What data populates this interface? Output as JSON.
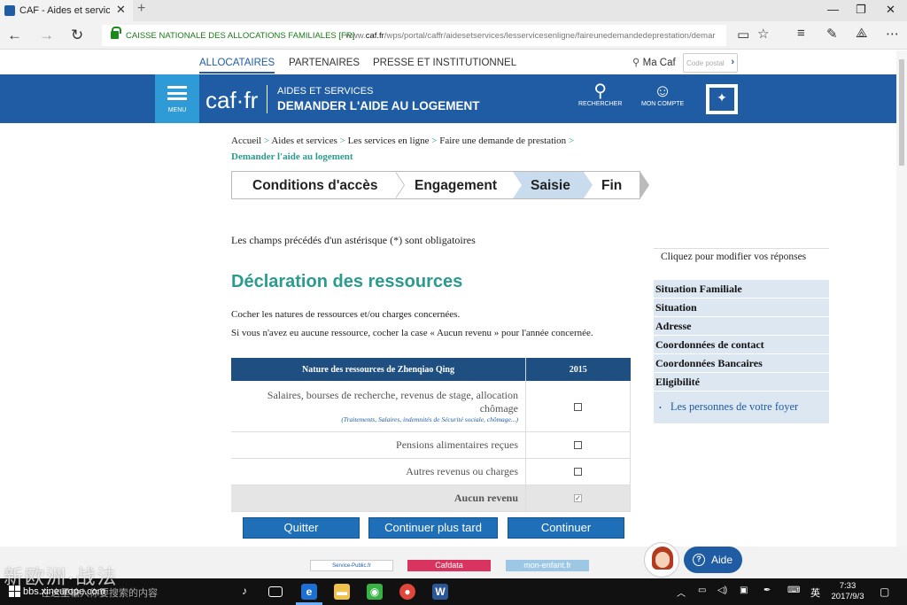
{
  "browser": {
    "tab_title": "CAF - Aides et services",
    "tab_close": "✕",
    "new_tab": "+",
    "org_name": "CAISSE NATIONALE DES ALLOCATIONS FAMILIALES [FR]",
    "url_prefix": "www.",
    "url_domain": "caf.fr",
    "url_path": "/wps/portal/caffr/aidesetservices/lesservicesenligne/faireunedemandedeprestation/demar"
  },
  "topnav": {
    "links": [
      "ALLOCATAIRES",
      "PARTENAIRES",
      "PRESSE ET INSTITUTIONNEL"
    ],
    "ma_caf": "Ma Caf",
    "postal_placeholder": "Code postal"
  },
  "header": {
    "menu_label": "MENU",
    "logo": "caf·fr",
    "title_small": "AIDES ET SERVICES",
    "title_big": "DEMANDER L'AIDE AU LOGEMENT",
    "search_label": "RECHERCHER",
    "account_label": "MON COMPTE"
  },
  "breadcrumb": {
    "items": [
      "Accueil",
      "Aides et services",
      "Les services en ligne",
      "Faire une demande de prestation"
    ],
    "separator": ">",
    "current": "Demander l'aide au logement"
  },
  "steps": [
    "Conditions d'accès",
    "Engagement",
    "Saisie",
    "Fin"
  ],
  "form": {
    "mandatory_note": "Les champs précédés d'un astérisque (*) sont obligatoires",
    "heading": "Déclaration des ressources",
    "instruction1": "Cocher les natures de ressources et/ou charges concernées.",
    "instruction2": "Si vous n'avez eu aucune ressource, cocher la case « Aucun revenu » pour l'année concernée.",
    "table": {
      "col1": "Nature des ressources de Zhenqiao Qing",
      "col2": "2015",
      "rows": [
        {
          "label": "Salaires, bourses de recherche, revenus de stage, allocation chômage",
          "sub": "(Traitements, Salaires, indemnités de Sécurité sociale, chômage...)",
          "checked": false
        },
        {
          "label": "Pensions alimentaires reçues",
          "checked": false
        },
        {
          "label": "Autres revenus ou charges",
          "checked": false
        },
        {
          "label": "Aucun revenu",
          "checked": true
        }
      ]
    },
    "buttons": {
      "quit": "Quitter",
      "later": "Continuer plus tard",
      "continue": "Continuer"
    }
  },
  "sidebar": {
    "head": "Cliquez pour modifier vos réponses",
    "items": [
      "Situation Familiale",
      "Situation",
      "Adresse",
      "Coordonnées de contact",
      "Coordonnées Bancaires",
      "Eligibilité"
    ],
    "sub_item": "Les personnes de votre foyer"
  },
  "footer": {
    "logos": [
      "Service-Public.fr",
      "Cafdata",
      "mon-enfant.fr"
    ],
    "aide": "Aide"
  },
  "watermark": {
    "text": "新欧洲·战法",
    "site": "bbs.xineurope.com"
  },
  "taskbar": {
    "search_placeholder": "在这里输入你要搜索的内容",
    "ime": "英",
    "time": "7:33",
    "date": "2017/9/3"
  },
  "colors": {
    "brand_blue": "#1f5ca3",
    "accent_teal": "#2a9b8e",
    "menu_blue": "#2f9bd6",
    "table_head": "#1e4f80"
  }
}
